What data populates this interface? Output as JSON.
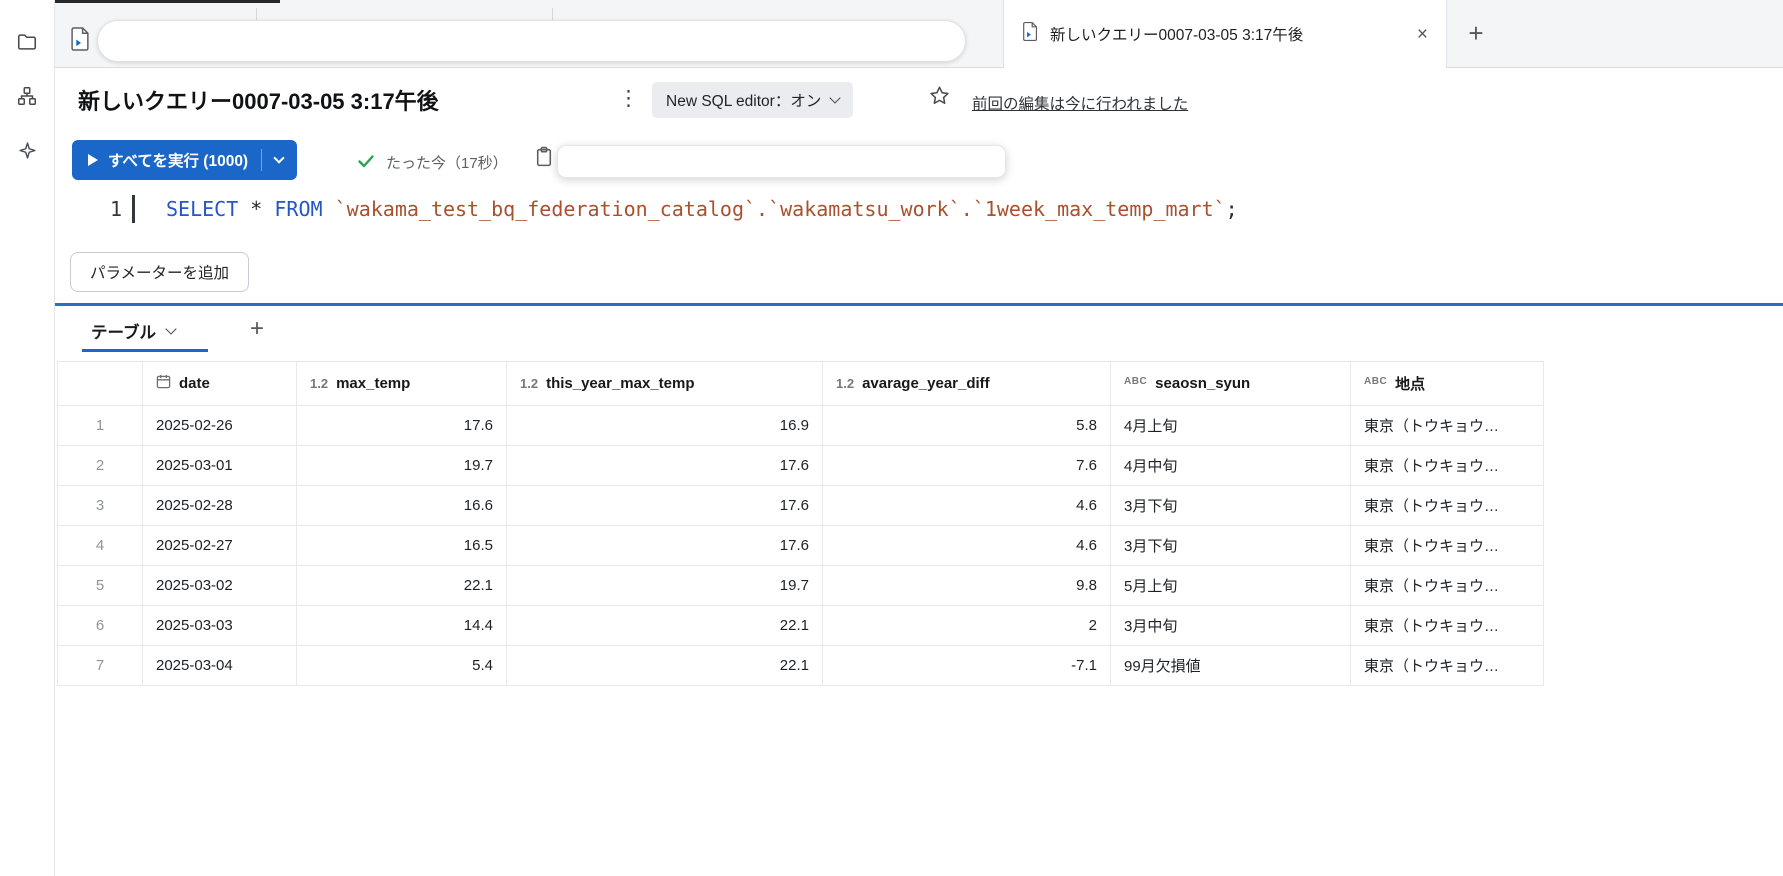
{
  "colors": {
    "accent_blue": "#1b66c9",
    "keyword_blue": "#2356c7",
    "identifier_red": "#a8512e",
    "success_green": "#23a455"
  },
  "icons": {
    "kebab": "⋮",
    "close": "×",
    "plus": "+"
  },
  "tab_bar": {
    "active_tab_title": "新しいクエリー0007-03-05 3:17午後"
  },
  "header": {
    "title": "新しいクエリー0007-03-05 3:17午後",
    "editor_toggle_label": "New SQL editor：オン",
    "last_edit_link": "前回の編集は今に行われました"
  },
  "toolbar": {
    "run_label": "すべてを実行 (1000)",
    "status_text": "たった今（17秒）"
  },
  "editor": {
    "line_number": "1",
    "tokens": {
      "select": "SELECT",
      "star": "*",
      "from": "FROM",
      "table_ref": "`wakama_test_bq_federation_catalog`.`wakamatsu_work`.`1week_max_temp_mart`",
      "semicolon": ";"
    }
  },
  "params_button_label": "パラメーターを追加",
  "results": {
    "tab_label": "テーブル",
    "table": {
      "type_icons": {
        "number": "1.2",
        "string": "ABC"
      },
      "columns": [
        {
          "key": "date",
          "label": "date",
          "type": "date",
          "align": "left"
        },
        {
          "key": "max_temp",
          "label": "max_temp",
          "type": "number",
          "align": "right"
        },
        {
          "key": "this_year_max_temp",
          "label": "this_year_max_temp",
          "type": "number",
          "align": "right"
        },
        {
          "key": "avarage_year_diff",
          "label": "avarage_year_diff",
          "type": "number",
          "align": "right"
        },
        {
          "key": "seaosn_syun",
          "label": "seaosn_syun",
          "type": "string",
          "align": "left"
        },
        {
          "key": "chiten",
          "label": "地点",
          "type": "string",
          "align": "left"
        }
      ],
      "rows": [
        {
          "n": "1",
          "cells": [
            "2025-02-26",
            "17.6",
            "16.9",
            "5.8",
            "4月上旬",
            "東京（トウキョウ…"
          ]
        },
        {
          "n": "2",
          "cells": [
            "2025-03-01",
            "19.7",
            "17.6",
            "7.6",
            "4月中旬",
            "東京（トウキョウ…"
          ]
        },
        {
          "n": "3",
          "cells": [
            "2025-02-28",
            "16.6",
            "17.6",
            "4.6",
            "3月下旬",
            "東京（トウキョウ…"
          ]
        },
        {
          "n": "4",
          "cells": [
            "2025-02-27",
            "16.5",
            "17.6",
            "4.6",
            "3月下旬",
            "東京（トウキョウ…"
          ]
        },
        {
          "n": "5",
          "cells": [
            "2025-03-02",
            "22.1",
            "19.7",
            "9.8",
            "5月上旬",
            "東京（トウキョウ…"
          ]
        },
        {
          "n": "6",
          "cells": [
            "2025-03-03",
            "14.4",
            "22.1",
            "2",
            "3月中旬",
            "東京（トウキョウ…"
          ]
        },
        {
          "n": "7",
          "cells": [
            "2025-03-04",
            "5.4",
            "22.1",
            "-7.1",
            "99月欠損値",
            "東京（トウキョウ…"
          ]
        }
      ]
    }
  }
}
